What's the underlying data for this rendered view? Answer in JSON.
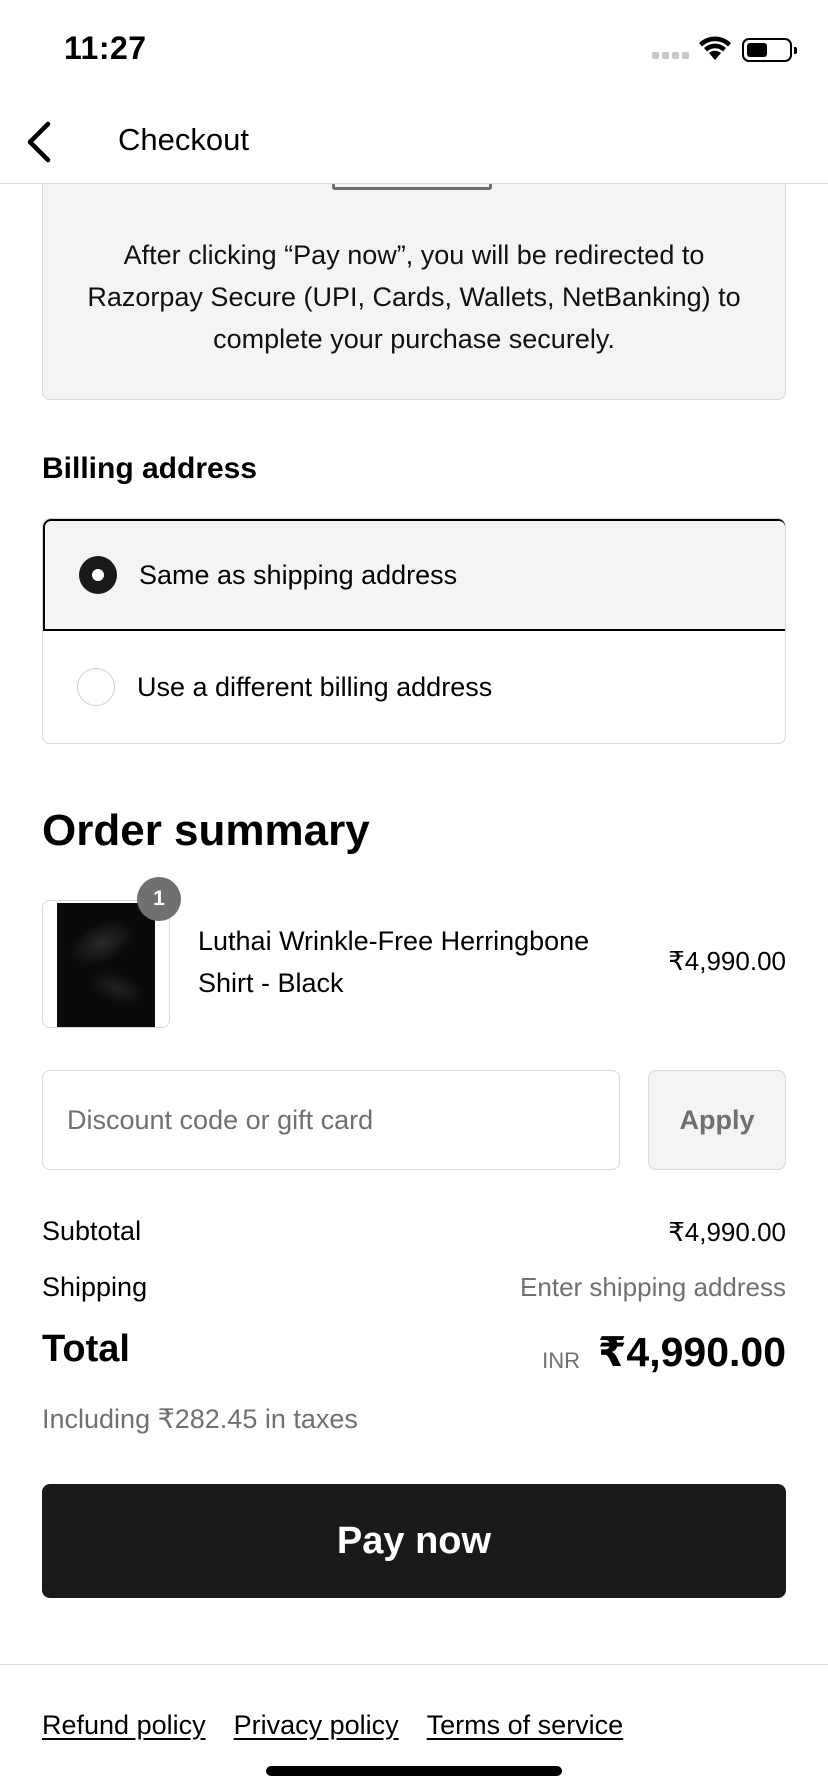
{
  "status_bar": {
    "time": "11:27",
    "icons": [
      "signal-icon",
      "wifi-icon",
      "battery-icon"
    ]
  },
  "header": {
    "back_icon": "chevron-left-icon",
    "title": "Checkout"
  },
  "payment_info": {
    "text": "After clicking “Pay now”, you will be redirected to Razorpay Secure (UPI, Cards, Wallets, NetBanking) to complete your purchase securely."
  },
  "billing": {
    "title": "Billing address",
    "options": [
      {
        "label": "Same as shipping address",
        "selected": true
      },
      {
        "label": "Use a different billing address",
        "selected": false
      }
    ]
  },
  "order_summary": {
    "title": "Order summary",
    "items": [
      {
        "name": "Luthai Wrinkle-Free Herringbone Shirt - Black",
        "quantity": "1",
        "price": "₹4,990.00"
      }
    ]
  },
  "discount": {
    "placeholder": "Discount code or gift card",
    "value": "",
    "apply_label": "Apply"
  },
  "totals": {
    "subtotal_label": "Subtotal",
    "subtotal_value": "₹4,990.00",
    "shipping_label": "Shipping",
    "shipping_value": "Enter shipping address",
    "total_label": "Total",
    "currency": "INR",
    "total_value": "₹4,990.00",
    "tax_note": "Including ₹282.45 in taxes"
  },
  "pay_button": {
    "label": "Pay now"
  },
  "footer": {
    "links": [
      "Refund policy",
      "Privacy policy",
      "Terms of service"
    ]
  },
  "colors": {
    "primary_button": "#1a1a1a",
    "muted_text": "#707070",
    "panel_background": "#f4f4f4",
    "border": "#d9d9d9"
  }
}
